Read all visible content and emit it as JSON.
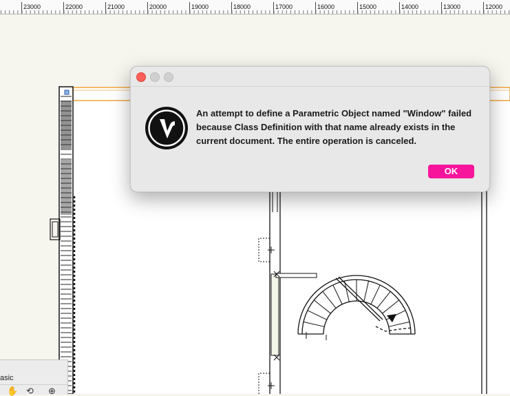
{
  "ruler": {
    "labels": [
      "23000",
      "22000",
      "21000",
      "20000",
      "19000",
      "18000",
      "17000",
      "16000",
      "15000",
      "14000",
      "13000",
      "12000"
    ]
  },
  "dialog": {
    "message": "An attempt to define a Parametric Object named \"Window\" failed because Class Definition with that name already exists in the current document.  The entire operation is canceled.",
    "ok_label": "OK",
    "accent_color": "#f7159b",
    "app_icon": "vectorworks-logo-icon"
  },
  "palette": {
    "title": "asic",
    "tools": [
      "pan-hand-icon",
      "flyover-icon",
      "zoom-icon"
    ]
  }
}
